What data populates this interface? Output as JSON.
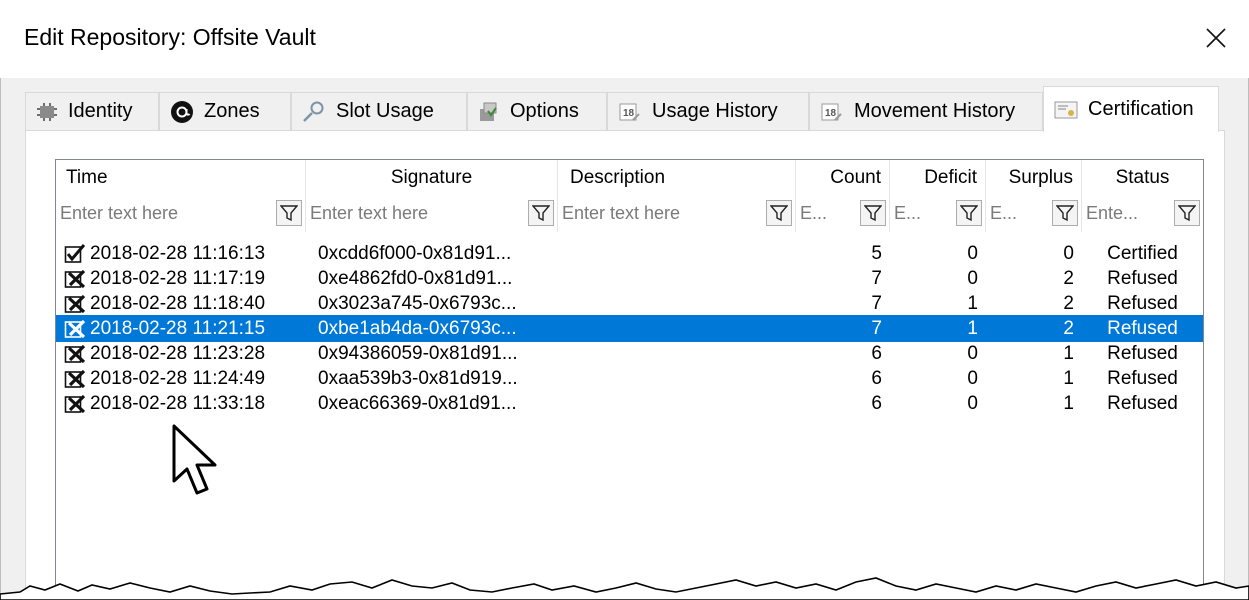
{
  "window": {
    "title": "Edit Repository: Offsite Vault",
    "close_icon": "close-icon"
  },
  "tabs": [
    {
      "label": "Identity",
      "icon": "gear-chip-icon",
      "active": false
    },
    {
      "label": "Zones",
      "icon": "at-sign-icon",
      "active": false
    },
    {
      "label": "Slot Usage",
      "icon": "magnifier-icon",
      "active": false
    },
    {
      "label": "Options",
      "icon": "options-icon",
      "active": false
    },
    {
      "label": "Usage History",
      "icon": "calendar-icon",
      "active": false
    },
    {
      "label": "Movement History",
      "icon": "calendar-icon",
      "active": false
    },
    {
      "label": "Certification",
      "icon": "certificate-icon",
      "active": true
    }
  ],
  "grid": {
    "columns": [
      {
        "label": "Time",
        "filter_placeholder": "Enter text here"
      },
      {
        "label": "Signature",
        "filter_placeholder": "Enter text here"
      },
      {
        "label": "Description",
        "filter_placeholder": "Enter text here"
      },
      {
        "label": "Count",
        "filter_placeholder": "E..."
      },
      {
        "label": "Deficit",
        "filter_placeholder": "E..."
      },
      {
        "label": "Surplus",
        "filter_placeholder": "E..."
      },
      {
        "label": "Status",
        "filter_placeholder": "Ente..."
      }
    ],
    "rows": [
      {
        "icon": "checkmark-icon",
        "time": "2018-02-28 11:16:13",
        "signature": "0xcdd6f000-0x81d91...",
        "description": "",
        "count": "5",
        "deficit": "0",
        "surplus": "0",
        "status": "Certified",
        "selected": false
      },
      {
        "icon": "x-mark-icon",
        "time": "2018-02-28 11:17:19",
        "signature": "0xe4862fd0-0x81d91...",
        "description": "",
        "count": "7",
        "deficit": "0",
        "surplus": "2",
        "status": "Refused",
        "selected": false
      },
      {
        "icon": "x-mark-icon",
        "time": "2018-02-28 11:18:40",
        "signature": "0x3023a745-0x6793c...",
        "description": "",
        "count": "7",
        "deficit": "1",
        "surplus": "2",
        "status": "Refused",
        "selected": false
      },
      {
        "icon": "x-mark-icon",
        "time": "2018-02-28 11:21:15",
        "signature": "0xbe1ab4da-0x6793c...",
        "description": "",
        "count": "7",
        "deficit": "1",
        "surplus": "2",
        "status": "Refused",
        "selected": true
      },
      {
        "icon": "x-mark-icon",
        "time": "2018-02-28 11:23:28",
        "signature": "0x94386059-0x81d91...",
        "description": "",
        "count": "6",
        "deficit": "0",
        "surplus": "1",
        "status": "Refused",
        "selected": false
      },
      {
        "icon": "x-mark-icon",
        "time": "2018-02-28 11:24:49",
        "signature": "0xaa539b3-0x81d919...",
        "description": "",
        "count": "6",
        "deficit": "0",
        "surplus": "1",
        "status": "Refused",
        "selected": false
      },
      {
        "icon": "x-mark-icon",
        "time": "2018-02-28 11:33:18",
        "signature": "0xeac66369-0x81d91...",
        "description": "",
        "count": "6",
        "deficit": "0",
        "surplus": "1",
        "status": "Refused",
        "selected": false
      }
    ]
  },
  "colors": {
    "selection": "#0078d7",
    "grid_border": "#828790",
    "tab_border": "#d9d9d9"
  }
}
